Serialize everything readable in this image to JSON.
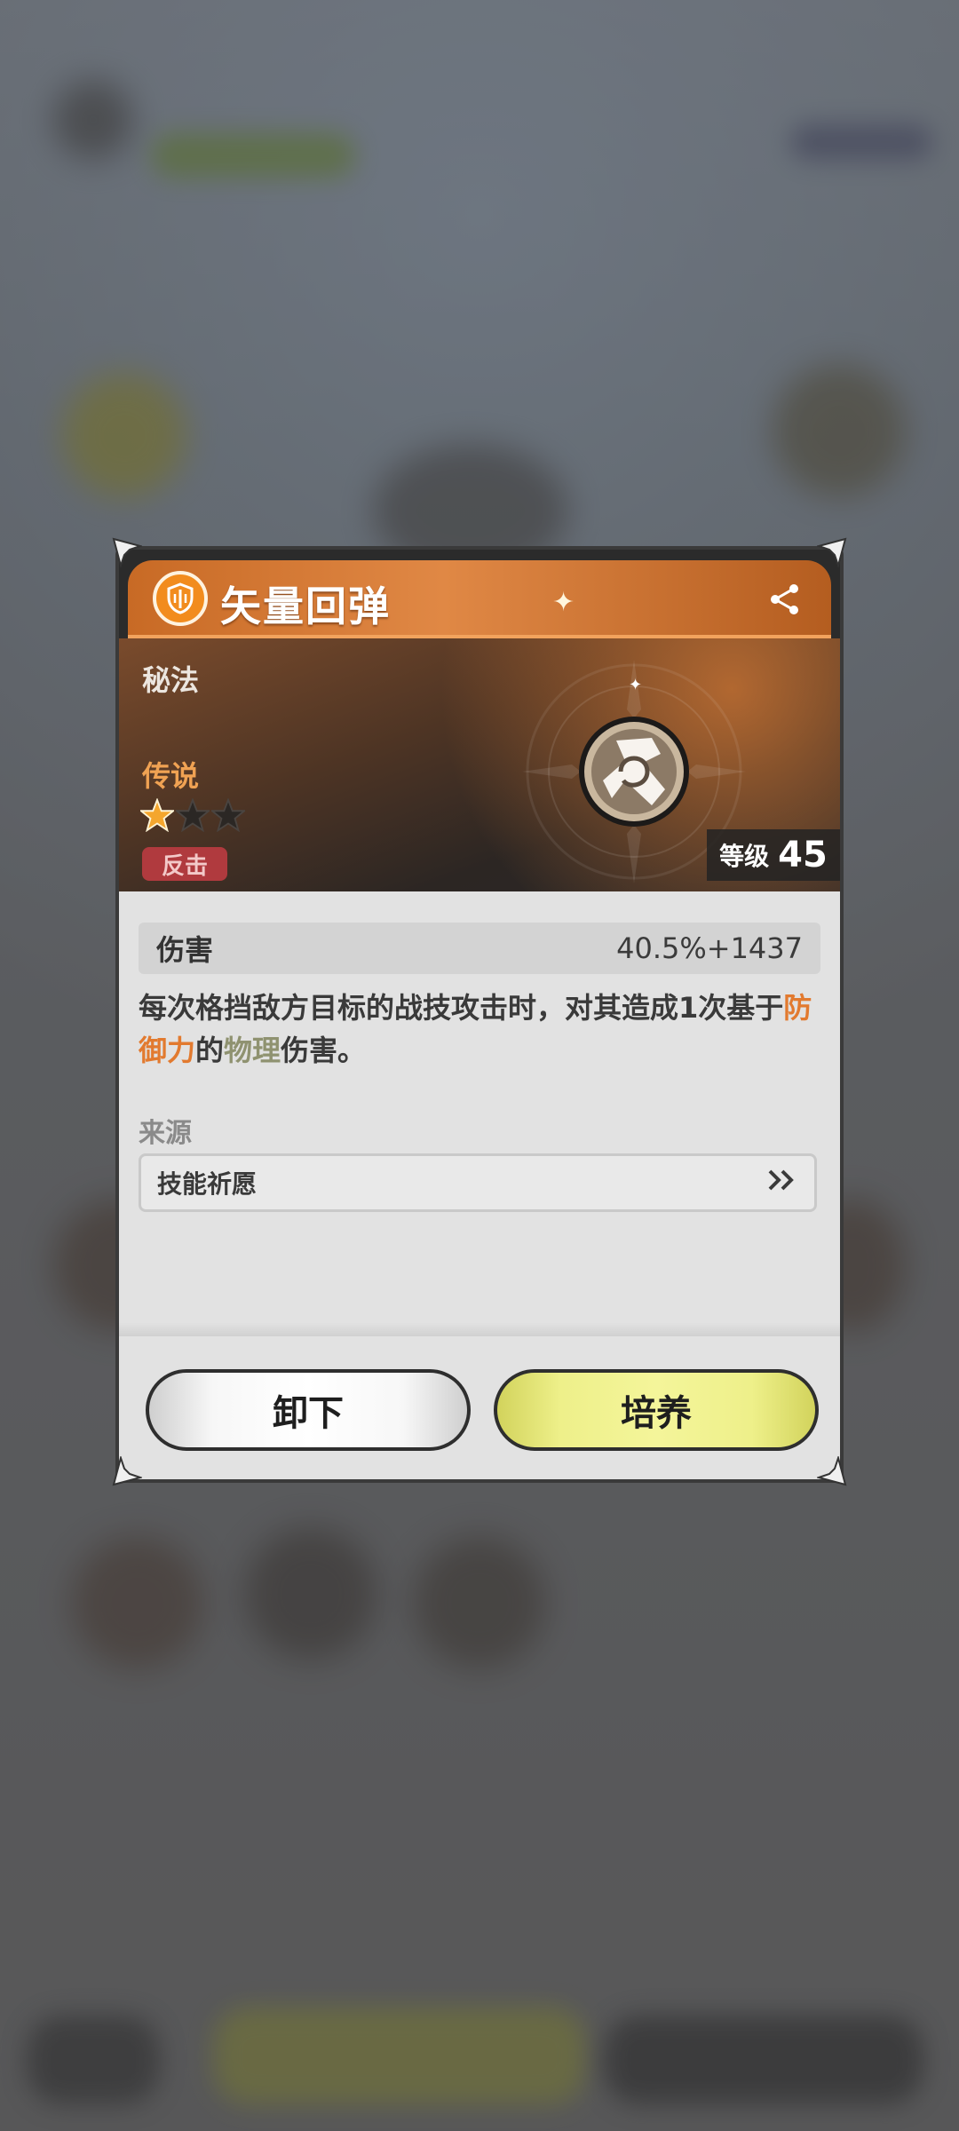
{
  "item": {
    "name": "矢量回弹",
    "category": "秘法",
    "rarity": "传说",
    "stars_filled": 1,
    "stars_total": 3,
    "tag": "反击",
    "level_label": "等级",
    "level_value": "45"
  },
  "stat": {
    "name": "伤害",
    "value": "40.5%+1437"
  },
  "description": {
    "part1": "每次格挡敌方目标的战技攻击时，对其造成1次基于",
    "highlight1": "防御力",
    "part2": "的",
    "highlight2": "物理",
    "part3": "伤害。"
  },
  "source": {
    "label": "来源",
    "item": "技能祈愿",
    "arrow": "»"
  },
  "buttons": {
    "unequip": "卸下",
    "upgrade": "培养"
  },
  "colors": {
    "title_orange": "#e08845",
    "highlight_orange": "#e27a2f",
    "highlight_olive": "#8f9270",
    "tag_red": "#b03a3e",
    "upgrade_yellow": "#eef08a"
  },
  "icons": [
    "shield-emblem-icon",
    "share-icon",
    "star-icon",
    "double-chevron-right-icon",
    "skill-emblem-icon"
  ]
}
